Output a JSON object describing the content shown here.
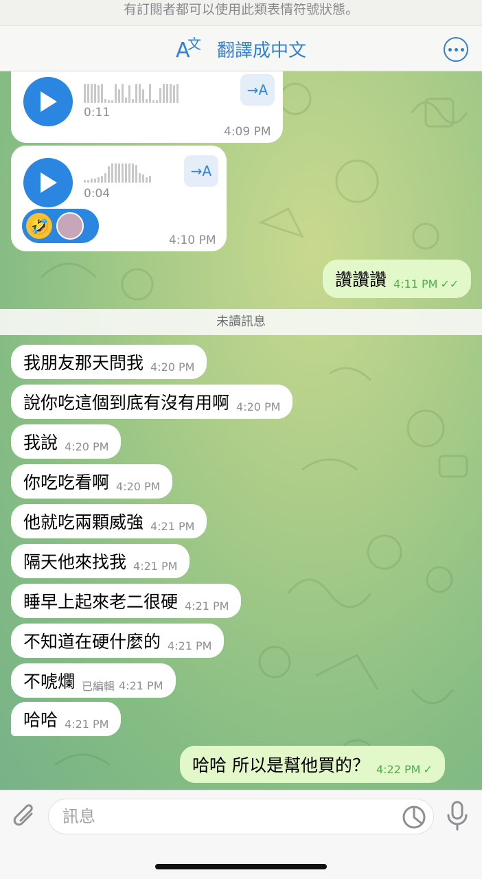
{
  "banner": {
    "text": "有訂閱者都可以使用此類表情符號狀態。"
  },
  "translate_bar": {
    "label": "翻譯成中文"
  },
  "voice_messages": [
    {
      "duration": "0:11",
      "time": "4:09 PM",
      "translate_label": "→A"
    },
    {
      "duration": "0:04",
      "time": "4:10 PM",
      "translate_label": "→A",
      "reaction_emoji": "🤣"
    }
  ],
  "outgoing_1": {
    "text": "讚讚讚",
    "time": "4:11 PM",
    "check": "✓✓"
  },
  "unread_label": "未讀訊息",
  "incoming": [
    {
      "text": "我朋友那天問我",
      "time": "4:20 PM"
    },
    {
      "text": "說你吃這個到底有沒有用啊",
      "time": "4:20 PM"
    },
    {
      "text": "我說",
      "time": "4:20 PM"
    },
    {
      "text": "你吃吃看啊",
      "time": "4:20 PM"
    },
    {
      "text": "他就吃兩顆威強",
      "time": "4:21 PM"
    },
    {
      "text": "隔天他來找我",
      "time": "4:21 PM"
    },
    {
      "text": "睡早上起來老二很硬",
      "time": "4:21 PM"
    },
    {
      "text": "不知道在硬什麼的",
      "time": "4:21 PM"
    },
    {
      "text": "不唬爛",
      "edited": "已編輯",
      "time": "4:21 PM"
    },
    {
      "text": "哈哈",
      "time": "4:21 PM"
    }
  ],
  "outgoing_2": {
    "text": "哈哈 所以是幫他買的？",
    "time": "4:22 PM",
    "check": "✓"
  },
  "input": {
    "placeholder": "訊息"
  },
  "colors": {
    "accent": "#2a86e0",
    "outgoing_bubble": "#e3f8c9",
    "check_green": "#4fae4e"
  }
}
